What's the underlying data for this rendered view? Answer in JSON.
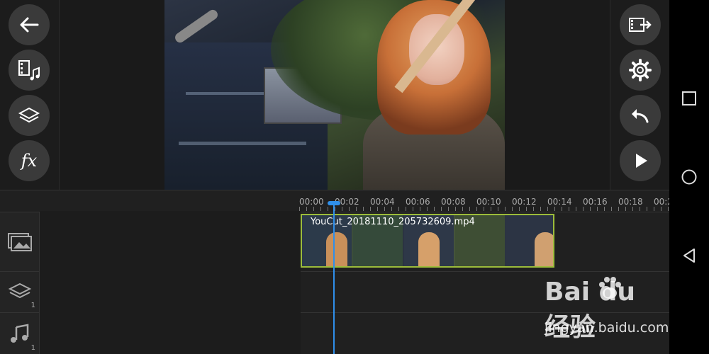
{
  "left_tools": [
    {
      "id": "back",
      "icon": "back-arrow-icon"
    },
    {
      "id": "media",
      "icon": "media-music-icon"
    },
    {
      "id": "layers",
      "icon": "layers-icon"
    },
    {
      "id": "effects",
      "icon": "fx-icon",
      "label": "fx"
    }
  ],
  "right_tools": [
    {
      "id": "export",
      "icon": "export-film-icon"
    },
    {
      "id": "settings",
      "icon": "gear-icon"
    },
    {
      "id": "undo",
      "icon": "undo-icon"
    },
    {
      "id": "play",
      "icon": "play-icon"
    }
  ],
  "timeline": {
    "ruler_labels": [
      "00:00",
      "00:02",
      "00:04",
      "00:06",
      "00:08",
      "00:10",
      "00:12",
      "00:14",
      "00:16",
      "00:18",
      "00:2"
    ],
    "clip": {
      "label": "YouCut_20181110_205732609.mp4"
    },
    "tracks": [
      {
        "id": "video",
        "icon": "video-track-icon",
        "count": ""
      },
      {
        "id": "layer",
        "icon": "layer-track-icon",
        "count": "1"
      },
      {
        "id": "audio",
        "icon": "audio-track-icon",
        "count": "1"
      }
    ]
  },
  "nav": [
    {
      "id": "recents",
      "icon": "square-icon"
    },
    {
      "id": "home",
      "icon": "circle-icon"
    },
    {
      "id": "back",
      "icon": "triangle-back-icon"
    }
  ],
  "watermark": {
    "brand": "Bai  du 经验",
    "url": "jingyan.baidu.com"
  },
  "colors": {
    "accent": "#2f8fea",
    "clip_border": "#9cbc3a",
    "button_bg": "#3a3a3a"
  }
}
